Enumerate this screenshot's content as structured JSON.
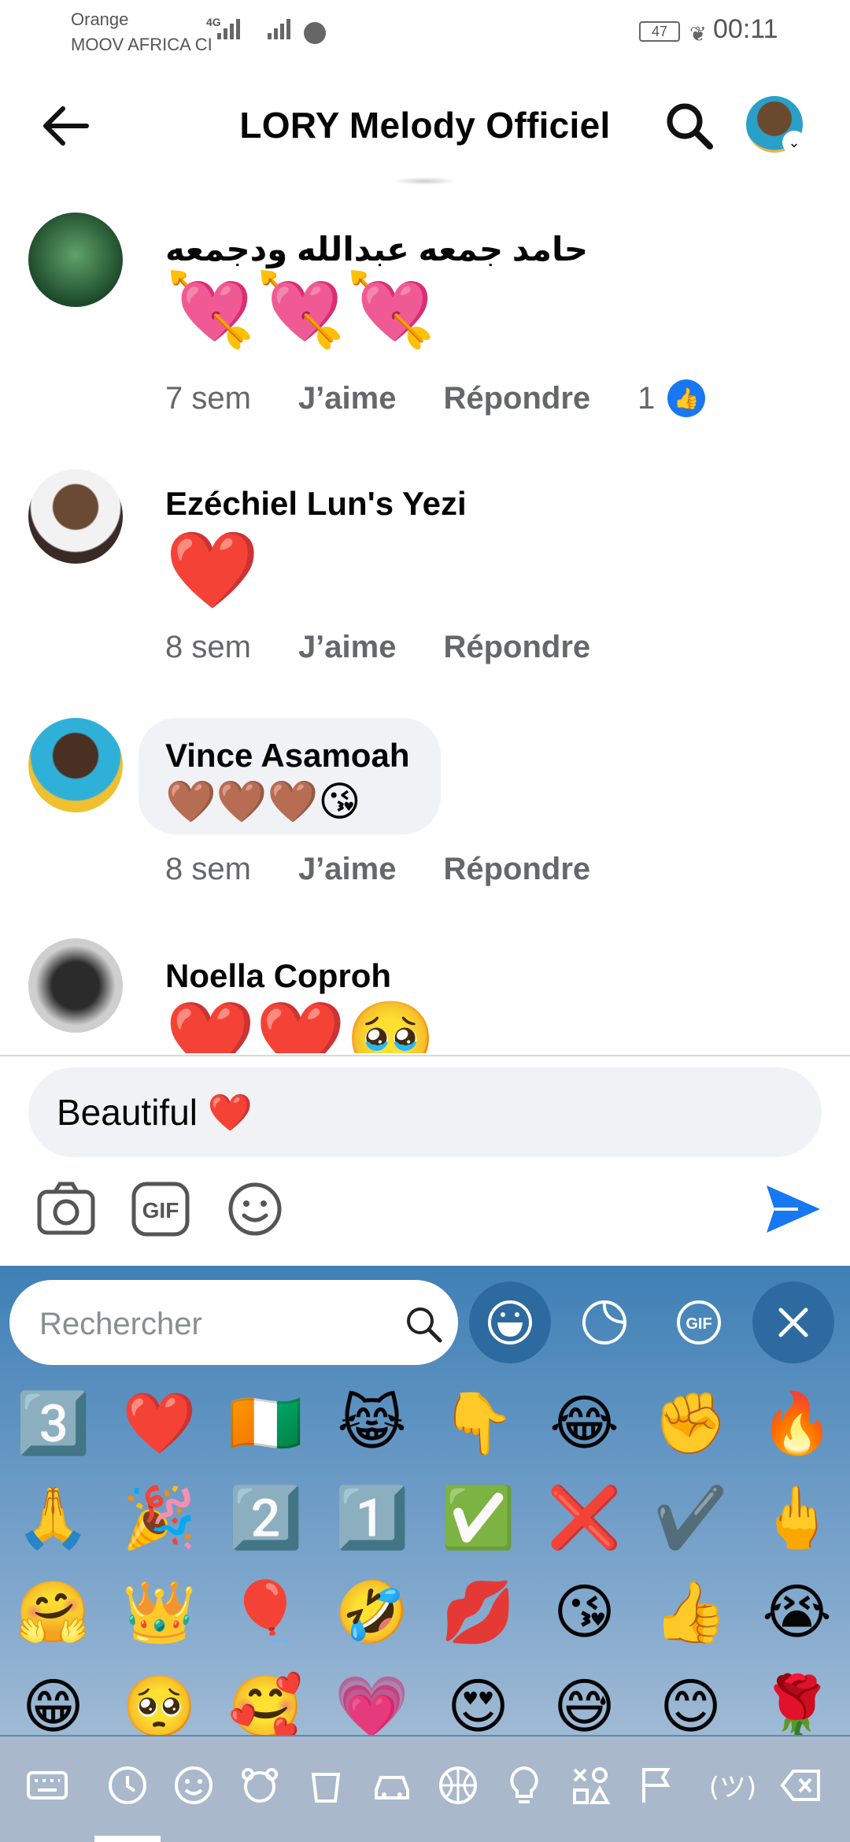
{
  "status_bar": {
    "carrier_1": "Orange",
    "carrier_2": "MOOV AFRICA CI",
    "network": "4G",
    "battery": "47",
    "time": "00:11"
  },
  "header": {
    "title": "LORY Melody Officiel",
    "back_icon": "arrow-left-icon",
    "search_icon": "search-icon"
  },
  "comments": [
    {
      "name": "حامد جمعه عبدالله ودجمعه",
      "body": "💘💘💘",
      "time": "7 sem",
      "like_label": "J’aime",
      "reply_label": "Répondre",
      "like_count": "1"
    },
    {
      "name": "Ezéchiel Lun's Yezi",
      "body": "❤️",
      "time": "8 sem",
      "like_label": "J’aime",
      "reply_label": "Répondre"
    },
    {
      "name": "Vince Asamoah",
      "body": "🤎🤎🤎😘",
      "time": "8 sem",
      "like_label": "J’aime",
      "reply_label": "Répondre"
    },
    {
      "name": "Noella Coproh",
      "body": "❤️❤️🥹"
    }
  ],
  "composer": {
    "value": "Beautiful ❤️",
    "tools": [
      "camera-icon",
      "gif-icon",
      "emoji-icon"
    ],
    "send_icon": "send-icon"
  },
  "emoji_keyboard": {
    "search_placeholder": "Rechercher",
    "tabs": [
      "emoji-tab",
      "sticker-tab",
      "gif-tab",
      "close-icon"
    ],
    "emojis": [
      "3️⃣",
      "❤️",
      "🇨🇮",
      "😹",
      "👇",
      "😂",
      "✊",
      "🔥",
      "🙏",
      "🎉",
      "2️⃣",
      "1️⃣",
      "✅",
      "❌",
      "✔️",
      "🖕",
      "🤗",
      "👑",
      "🎈",
      "🤣",
      "💋",
      "😘",
      "👍",
      "😭",
      "😁",
      "🥺",
      "🥰",
      "💗",
      "😍",
      "😅",
      "😊",
      "🌹"
    ],
    "categories": [
      "keyboard-icon",
      "clock-icon",
      "smiley-icon",
      "bear-icon",
      "cup-icon",
      "car-icon",
      "ball-icon",
      "bulb-icon",
      "symbols-icon",
      "flag-icon",
      "kaomoji-icon",
      "backspace-icon"
    ]
  },
  "colors": {
    "accent": "#1877f2",
    "meta_text": "#65676b",
    "bubble": "#f0f2f5",
    "keyboard_top": "#3f80b6"
  }
}
